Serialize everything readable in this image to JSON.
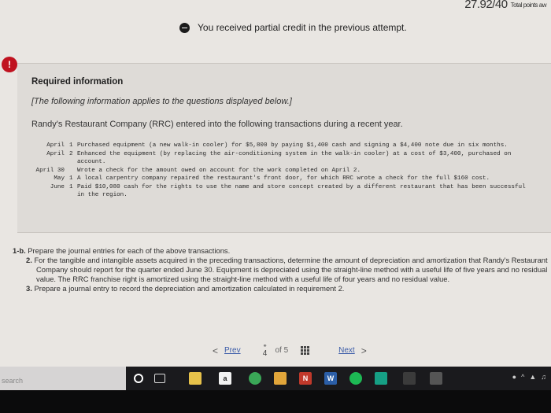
{
  "header": {
    "score": "27.92/40",
    "total_points_label": "Total points aw"
  },
  "banner": {
    "partial_credit": "You received partial credit in the previous attempt."
  },
  "alert_icon": "exclamation-icon",
  "info": {
    "title": "Required information",
    "note": "[The following information applies to the questions displayed below.]",
    "intro": "Randy's Restaurant Company (RRC) entered into the following transactions during a recent year.",
    "transactions": [
      {
        "date": "April",
        "num": "1",
        "desc": "Purchased equipment (a new walk-in cooler) for $5,800 by paying $1,400 cash and signing a $4,400 note due in six months."
      },
      {
        "date": "April",
        "num": "2",
        "desc": "Enhanced the equipment (by replacing the air-conditioning system in the walk-in cooler) at a cost of $3,400, purchased on account."
      },
      {
        "date": "April 30",
        "num": "",
        "desc": "Wrote a check for the amount owed on account for the work completed on April 2."
      },
      {
        "date": "May",
        "num": "1",
        "desc": "A local carpentry company repaired the restaurant's front door, for which RRC wrote a check for the full $160 cost."
      },
      {
        "date": "June",
        "num": "1",
        "desc": "Paid $10,080 cash for the rights to use the name and store concept created by a different restaurant that has been successful in the region."
      }
    ]
  },
  "questions": {
    "q1b_label": "1-b.",
    "q1b": "Prepare the journal entries for each of the above transactions.",
    "q2_label": "2.",
    "q2": "For the tangible and intangible assets acquired in the preceding transactions, determine the amount of depreciation and amortization that Randy's Restaurant Company should report for the quarter ended June 30. Equipment is depreciated using the straight-line method with a useful life of five years and no residual value. The RRC franchise right is amortized using the straight-line method with a useful life of four years and no residual value.",
    "q3_label": "3.",
    "q3": "Prepare a journal entry to record the depreciation and amortization calculated in requirement 2."
  },
  "pager": {
    "prev_arrow": "<",
    "prev": "Prev",
    "current_page": "4",
    "of_label": "of 5",
    "next": "Next",
    "next_arrow": ">"
  },
  "taskbar": {
    "search_placeholder": "search",
    "icons": [
      "cortana-icon",
      "task-view-icon",
      "file-explorer-icon",
      "amazon-icon",
      "chrome-icon",
      "store-icon",
      "onenote-icon",
      "word-icon",
      "spotify-icon",
      "app-icon",
      "calculator-icon",
      "app-icon"
    ]
  }
}
